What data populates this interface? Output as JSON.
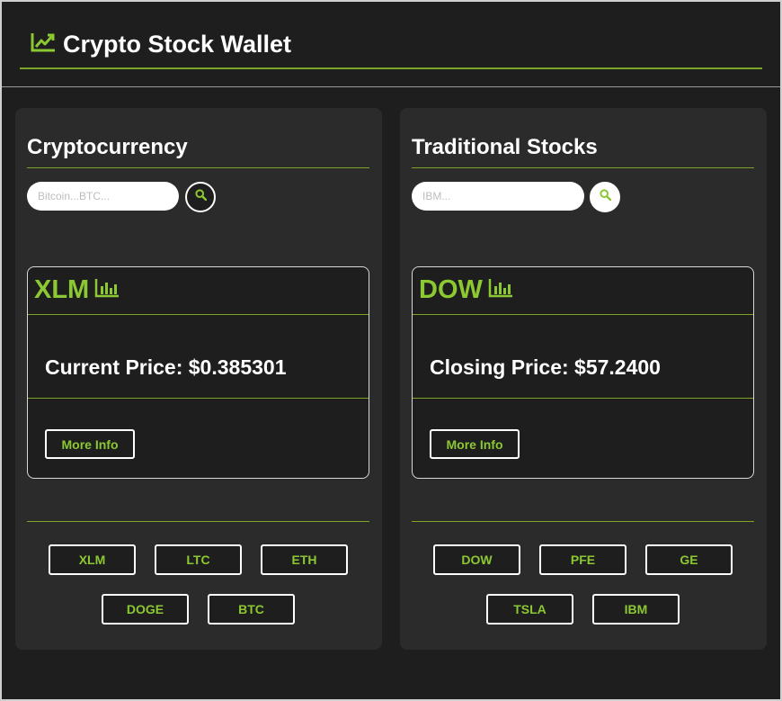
{
  "header": {
    "title": "Crypto Stock Wallet",
    "icon": "line-chart-icon",
    "accent_color": "#8cc832"
  },
  "crypto": {
    "title": "Cryptocurrency",
    "search_placeholder": "Bitcoin...BTC...",
    "card": {
      "symbol": "XLM",
      "price_text": "Current Price: $0.385301",
      "more_info_label": "More Info"
    },
    "tickers": [
      "XLM",
      "LTC",
      "ETH",
      "DOGE",
      "BTC"
    ]
  },
  "stocks": {
    "title": "Traditional Stocks",
    "search_placeholder": "IBM...",
    "card": {
      "symbol": "DOW",
      "price_text": "Closing Price: $57.2400",
      "more_info_label": "More Info"
    },
    "tickers": [
      "DOW",
      "PFE",
      "GE",
      "TSLA",
      "IBM"
    ]
  }
}
